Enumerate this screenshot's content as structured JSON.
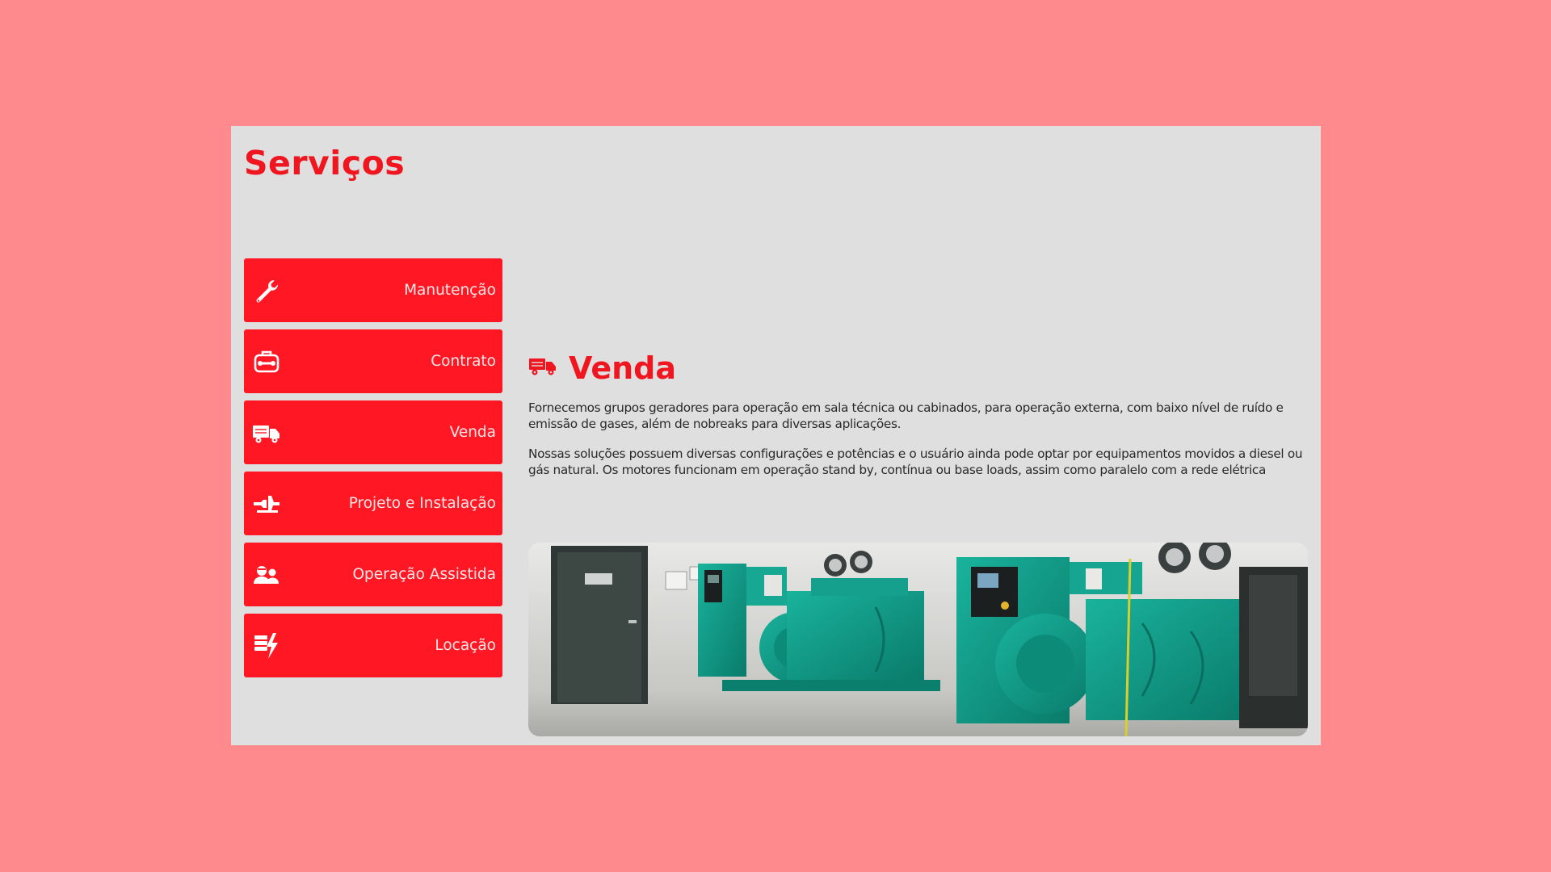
{
  "services": {
    "title": "Serviços",
    "menu": [
      {
        "label": "Manutenção",
        "icon": "wrench-icon"
      },
      {
        "label": "Contrato",
        "icon": "toolbox-icon"
      },
      {
        "label": "Venda",
        "icon": "truck-icon"
      },
      {
        "label": "Projeto e Instalação",
        "icon": "installation-icon"
      },
      {
        "label": "Operação Assistida",
        "icon": "operators-icon"
      },
      {
        "label": "Locação",
        "icon": "power-rental-icon"
      }
    ]
  },
  "detail": {
    "icon": "truck-icon",
    "title": "Venda",
    "paragraphs": [
      "Fornecemos grupos geradores para operação em sala técnica ou cabinados, para operação externa, com baixo nível de ruído e emissão de gases, além de nobreaks para diversas aplicações.",
      "Nossas soluções possuem diversas configurações e potências e o usuário ainda pode optar por equipamentos movidos a diesel ou gás natural. Os motores funcionam em operação stand by, contínua ou base loads, assim como paralelo com a rede elétrica"
    ]
  },
  "colors": {
    "page_background": "#ff8a8d",
    "panel": "#dfdfdf",
    "accent": "#f0161f",
    "button": "#ff1823",
    "generator_green": "#0e9e8a"
  }
}
